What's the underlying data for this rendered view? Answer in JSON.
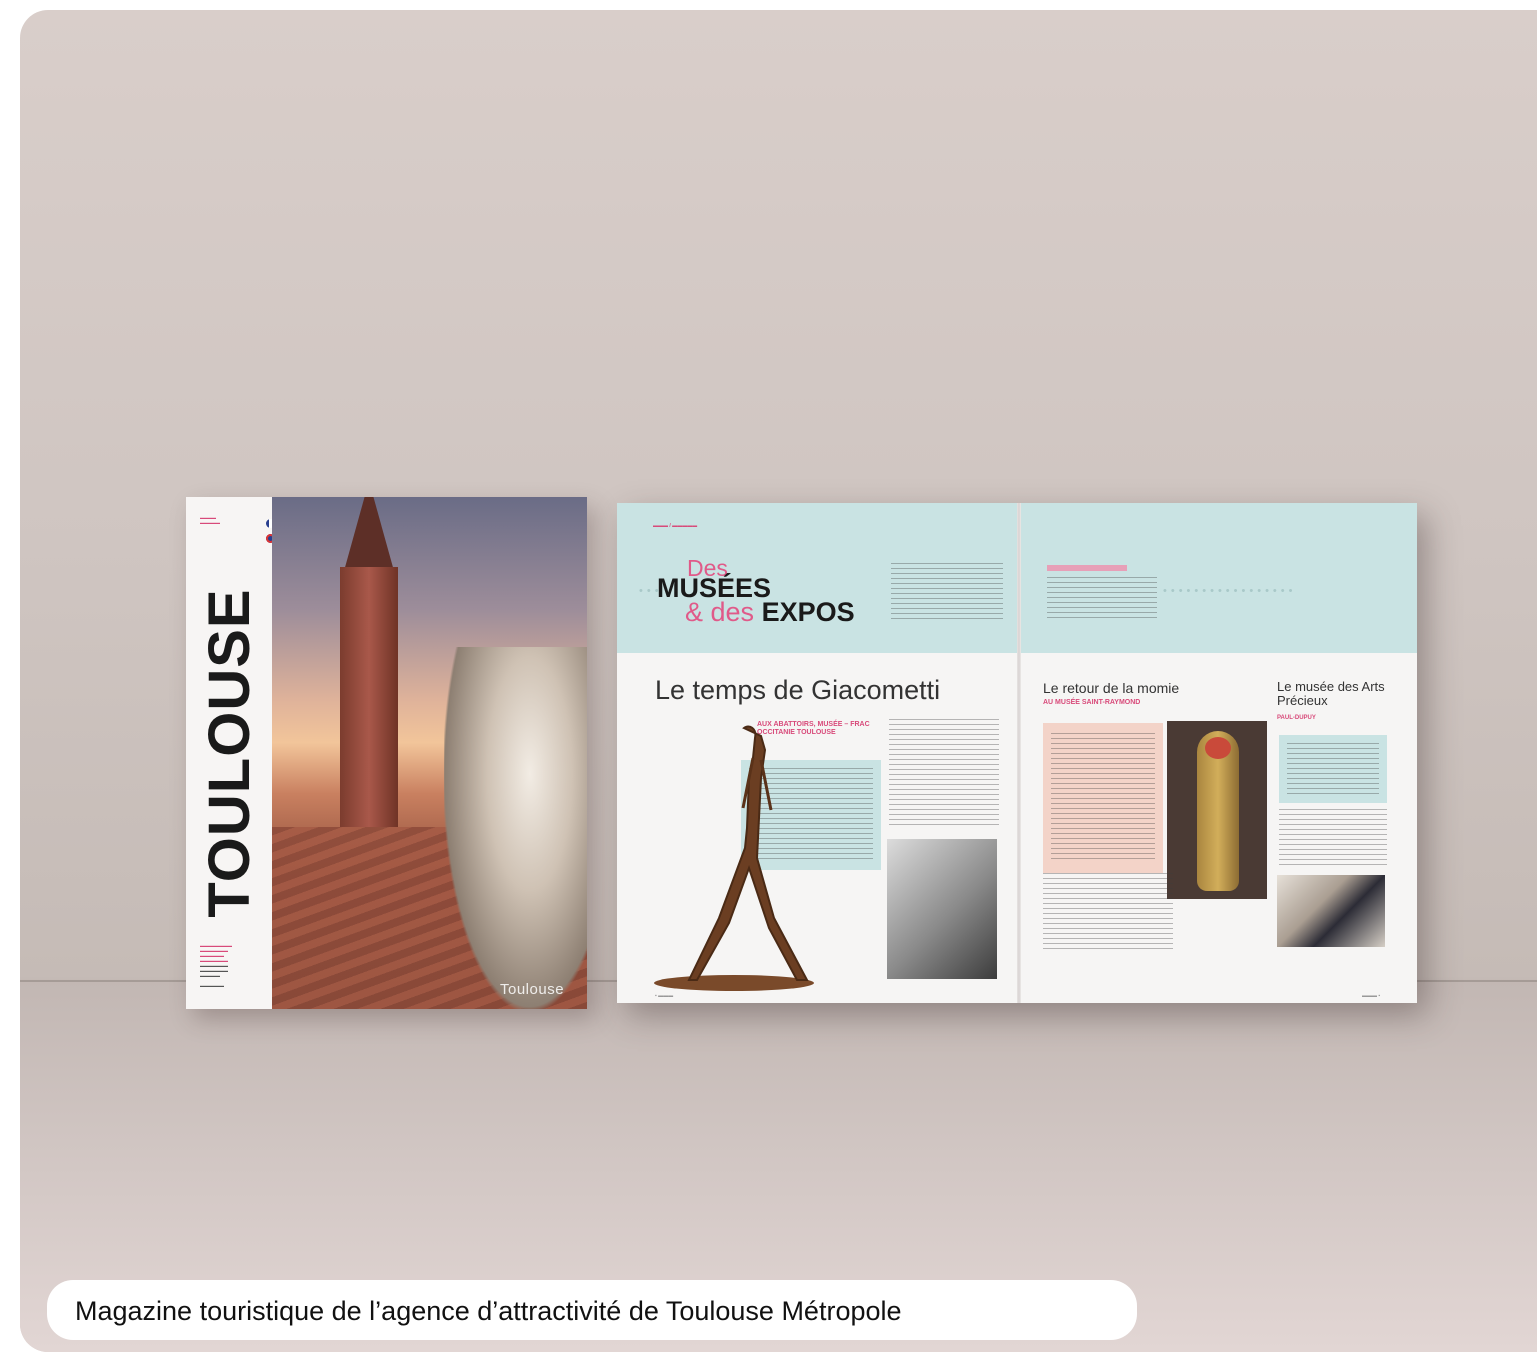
{
  "cover": {
    "title": "TOULOUSE",
    "logo_text": "Toulouse"
  },
  "spread": {
    "header_des": "Des",
    "header_musees": "MUSÉES",
    "header_and_des": "& des",
    "header_expos": "EXPOS",
    "headline_giacometti": "Le temps de Giacometti",
    "subhead_abattoirs": "AUX ABATTOIRS, MUSÉE – FRAC OCCITANIE TOULOUSE",
    "headline_momie": "Le retour de la momie",
    "subhead_momie": "AU MUSÉE SAINT-RAYMOND",
    "headline_arts": "Le musée des Arts Précieux",
    "subhead_arts": "PAUL-DUPUY"
  },
  "caption": {
    "text": "Magazine touristique de l’agence d’attractivité de Toulouse Métropole"
  },
  "colors": {
    "accent_pink": "#e05a89",
    "teal_panel": "#c9e3e3",
    "pink_panel": "#f3d3c8"
  }
}
